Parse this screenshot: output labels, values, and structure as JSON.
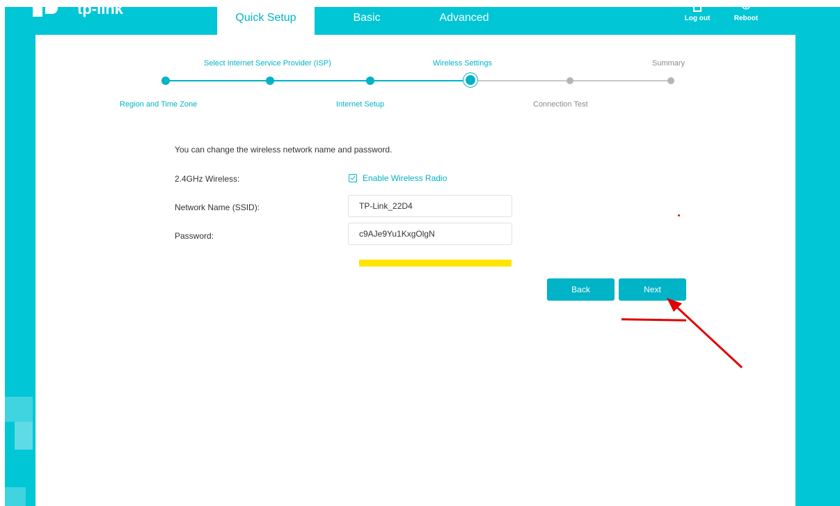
{
  "header": {
    "brand": "tp-link",
    "tabs": [
      {
        "label": "Quick Setup",
        "active": true
      },
      {
        "label": "Basic",
        "active": false
      },
      {
        "label": "Advanced",
        "active": false
      }
    ],
    "logout_label": "Log out",
    "reboot_label": "Reboot"
  },
  "steps": [
    {
      "label": "Region and Time Zone",
      "state": "done"
    },
    {
      "label": "Select Internet Service Provider (ISP)",
      "state": "done"
    },
    {
      "label": "Internet Setup",
      "state": "done"
    },
    {
      "label": "Wireless Settings",
      "state": "current"
    },
    {
      "label": "Connection Test",
      "state": "todo"
    },
    {
      "label": "Summary",
      "state": "todo"
    }
  ],
  "form": {
    "intro": "You can change the wireless network name and password.",
    "wireless_label": "2.4GHz Wireless:",
    "enable_radio_label": "Enable Wireless Radio",
    "enable_radio_checked": true,
    "ssid_label": "Network Name (SSID):",
    "ssid_value": "TP-Link_22D4",
    "password_label": "Password:",
    "password_value": "c9AJe9Yu1KxgOlgN"
  },
  "buttons": {
    "back_label": "Back",
    "next_label": "Next"
  },
  "colors": {
    "brand": "#00c6d6",
    "accent": "#00b3c6",
    "highlight": "#ffe400",
    "annotation": "#e00000"
  }
}
